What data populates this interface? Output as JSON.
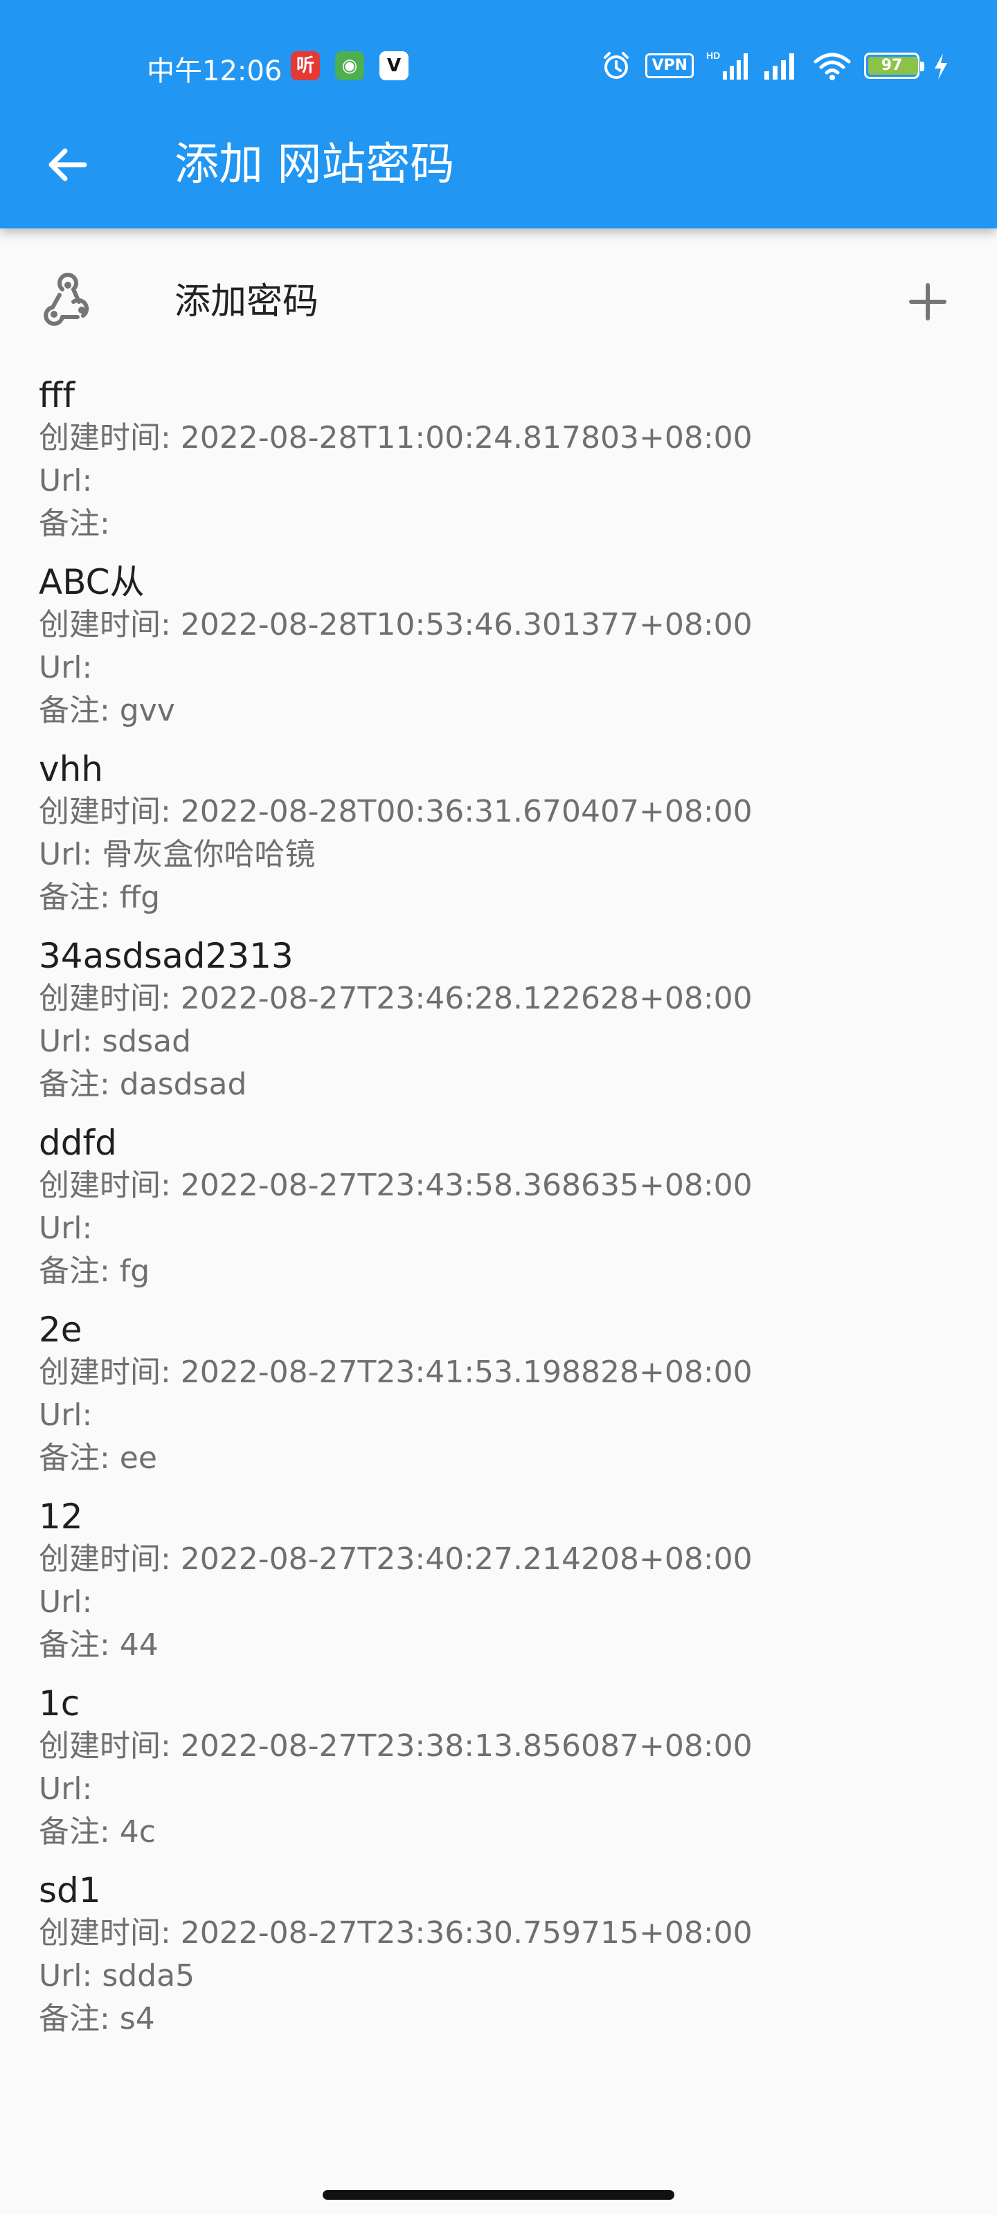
{
  "status_bar": {
    "time": "中午12:06",
    "app_icons": [
      "听",
      "◉",
      "V"
    ],
    "vpn": "VPN",
    "battery": "97",
    "battery_level": 0.97,
    "icons": [
      "alarm-icon",
      "hd-signal-icon",
      "signal-icon",
      "wifi-icon",
      "battery-icon",
      "charging-icon"
    ]
  },
  "app_bar": {
    "back_icon": "back-arrow-icon",
    "title": "添加 网站密码"
  },
  "add_row": {
    "icon": "webhook-icon",
    "label": "添加密码",
    "action_icon": "plus-icon"
  },
  "entries": [
    {
      "name": "fff",
      "created": "创建时间: 2022-08-28T11:00:24.817803+08:00",
      "url": "Url:",
      "note": "备注:"
    },
    {
      "name": "ABC从",
      "created": "创建时间: 2022-08-28T10:53:46.301377+08:00",
      "url": "Url:",
      "note": "备注: gvv"
    },
    {
      "name": "vhh",
      "created": "创建时间: 2022-08-28T00:36:31.670407+08:00",
      "url": "Url: 骨灰盒你哈哈镜",
      "note": "备注: ffg"
    },
    {
      "name": "34asdsad2313",
      "created": "创建时间: 2022-08-27T23:46:28.122628+08:00",
      "url": "Url: sdsad",
      "note": "备注: dasdsad"
    },
    {
      "name": "ddfd",
      "created": "创建时间: 2022-08-27T23:43:58.368635+08:00",
      "url": "Url:",
      "note": "备注: fg"
    },
    {
      "name": "2e",
      "created": "创建时间: 2022-08-27T23:41:53.198828+08:00",
      "url": "Url:",
      "note": "备注: ee"
    },
    {
      "name": "12",
      "created": "创建时间: 2022-08-27T23:40:27.214208+08:00",
      "url": "Url:",
      "note": "备注: 44"
    },
    {
      "name": "1c",
      "created": "创建时间: 2022-08-27T23:38:13.856087+08:00",
      "url": "Url:",
      "note": "备注: 4c"
    },
    {
      "name": "sd1",
      "created": "创建时间: 2022-08-27T23:36:30.759715+08:00",
      "url": "Url: sdda5",
      "note": "备注: s4"
    }
  ],
  "colors": {
    "primary": "#2196f3",
    "background": "#fafafa",
    "title_text": "#1f1f1f",
    "secondary_text": "#6f6f6f"
  }
}
